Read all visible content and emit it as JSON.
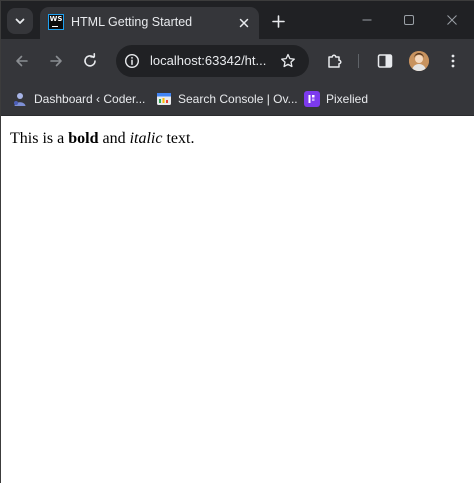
{
  "tab": {
    "favicon_text": "WS",
    "title": "HTML Getting Started"
  },
  "omnibox": {
    "url": "localhost:63342/ht..."
  },
  "bookmarks": [
    {
      "label": "Dashboard ‹ Coder...",
      "icon": "wordpress-icon"
    },
    {
      "label": "Search Console | Ov...",
      "icon": "search-console-icon"
    },
    {
      "label": "Pixelied",
      "icon": "pixelied-icon"
    }
  ],
  "page": {
    "text_before_bold": "This is a ",
    "bold": "bold",
    "text_middle": " and ",
    "italic": "italic",
    "text_after": " text."
  },
  "colors": {
    "frame": "#202124",
    "toolbar": "#35363a",
    "text": "#e8eaed",
    "pixelied": "#7c3aed"
  }
}
